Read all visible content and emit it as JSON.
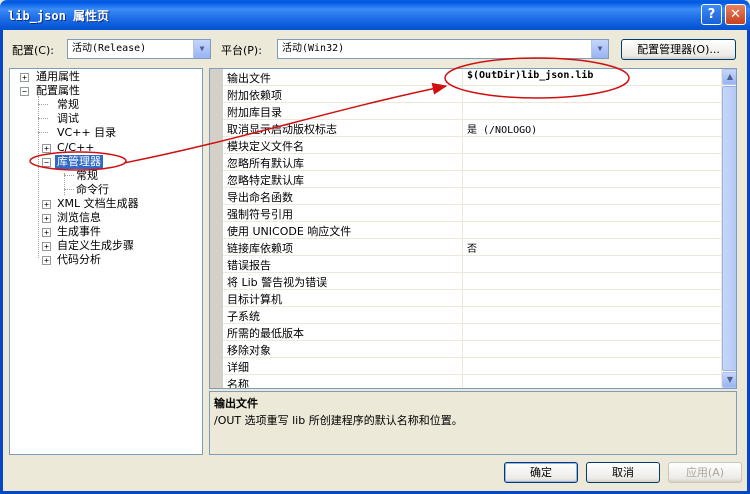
{
  "window": {
    "title": "lib_json 属性页",
    "help_btn": "?",
    "close_btn": "✕"
  },
  "toolbar": {
    "config_label": "配置(C):",
    "config_value": "活动(Release)",
    "platform_label": "平台(P):",
    "platform_value": "活动(Win32)",
    "config_manager_btn": "配置管理器(O)..."
  },
  "tree": {
    "items": [
      {
        "label": "通用属性",
        "expander": "+"
      },
      {
        "label": "配置属性",
        "expander": "−"
      },
      {
        "label": "常规"
      },
      {
        "label": "调试"
      },
      {
        "label": "VC++ 目录"
      },
      {
        "label": "C/C++",
        "expander": "+"
      },
      {
        "label": "库管理器",
        "expander": "−",
        "selected": true
      },
      {
        "label": "常规"
      },
      {
        "label": "命令行"
      },
      {
        "label": "XML 文档生成器",
        "expander": "+"
      },
      {
        "label": "浏览信息",
        "expander": "+"
      },
      {
        "label": "生成事件",
        "expander": "+"
      },
      {
        "label": "自定义生成步骤",
        "expander": "+"
      },
      {
        "label": "代码分析",
        "expander": "+"
      }
    ]
  },
  "properties": {
    "rows": [
      {
        "name": "输出文件",
        "value": "$(OutDir)lib_json.lib"
      },
      {
        "name": "附加依赖项",
        "value": ""
      },
      {
        "name": "附加库目录",
        "value": ""
      },
      {
        "name": "取消显示启动版权标志",
        "value": "是 (/NOLOGO)"
      },
      {
        "name": "模块定义文件名",
        "value": ""
      },
      {
        "name": "忽略所有默认库",
        "value": ""
      },
      {
        "name": "忽略特定默认库",
        "value": ""
      },
      {
        "name": "导出命名函数",
        "value": ""
      },
      {
        "name": "强制符号引用",
        "value": ""
      },
      {
        "name": "使用 UNICODE 响应文件",
        "value": ""
      },
      {
        "name": "链接库依赖项",
        "value": "否"
      },
      {
        "name": "错误报告",
        "value": ""
      },
      {
        "name": "将 Lib 警告视为错误",
        "value": ""
      },
      {
        "name": "目标计算机",
        "value": ""
      },
      {
        "name": "子系统",
        "value": ""
      },
      {
        "name": "所需的最低版本",
        "value": ""
      },
      {
        "name": "移除对象",
        "value": ""
      },
      {
        "name": "详细",
        "value": ""
      },
      {
        "name": "名称",
        "value": ""
      }
    ]
  },
  "description": {
    "title": "输出文件",
    "text": "/OUT 选项重写 lib 所创建程序的默认名称和位置。"
  },
  "buttons": {
    "ok": "确定",
    "cancel": "取消",
    "apply": "应用(A)"
  },
  "annotation_color": "#d01010"
}
